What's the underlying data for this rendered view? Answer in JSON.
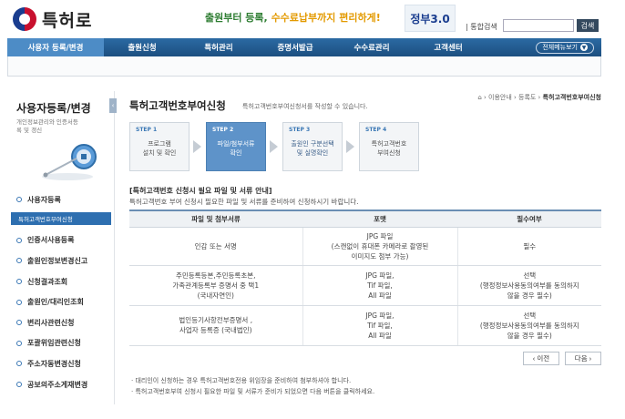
{
  "header": {
    "logo_text": "특허로",
    "slogan_prefix": "출원부터 등록, ",
    "slogan_highlight": "수수료납부까지 편리하게!",
    "gov_badge": "정부3.0",
    "search_label": "| 통합검색",
    "search_value": "",
    "search_button": "검색"
  },
  "gnb": {
    "items": [
      {
        "label": "사용자 등록/변경"
      },
      {
        "label": "출원신청"
      },
      {
        "label": "특허관리"
      },
      {
        "label": "증명서발급"
      },
      {
        "label": "수수료관리"
      },
      {
        "label": "고객센터"
      }
    ],
    "all_menu": "전체메뉴보기"
  },
  "sidebar": {
    "title": "사용자등록/변경",
    "desc": "개인정보관리와 인증서등록 및 갱신",
    "collapse": "‹",
    "items": [
      {
        "label": "사용자등록"
      },
      {
        "label": "인증서사용등록"
      },
      {
        "label": "출원인정보변경신고"
      },
      {
        "label": "신청결과조회"
      },
      {
        "label": "출원인/대리인조회"
      },
      {
        "label": "변리사관련신청"
      },
      {
        "label": "포괄위임관련신청"
      },
      {
        "label": "주소자동변경신청"
      },
      {
        "label": "공보의주소게재변경"
      }
    ],
    "sub_active": "특허고객번호부여신청"
  },
  "main": {
    "breadcrumb_prefix": "⌂ › 이용안내 › 등록도 › ",
    "breadcrumb_current": "특허고객번호부여신청",
    "title": "특허고객번호부여신청",
    "subtitle": "특허고객번호부여신청서를 작성할 수 있습니다.",
    "steps": [
      {
        "num": "STEP 1",
        "label": "프로그램\n설치 및 확인"
      },
      {
        "num": "STEP 2",
        "label": "파일/첨부서류\n확인"
      },
      {
        "num": "STEP 3",
        "label": "출원인 구분선택\n및 실명확인"
      },
      {
        "num": "STEP 4",
        "label": "특허고객번호\n부여신청"
      }
    ],
    "notice_title": "[특허고객번호 신청시 필요 파일 및 서류 안내]",
    "notice_sub": "특허고객번호 부여 신청시 필요한 파일 및 서류를 준비하여 신청하시기 바랍니다.",
    "table": {
      "headers": [
        "파일 및 첨부서류",
        "포맷",
        "필수여부"
      ],
      "rows": [
        {
          "doc": "인감 또는 서명",
          "format": "JPG 파일\n(스캔없이 휴대폰 카메라로 촬영된\n이미지도 첨부 가능)",
          "required": "필수"
        },
        {
          "doc": "주민등록등본,주민등록초본,\n가족관계등록부 증명서 중 택1\n(국내자연인)",
          "format": "JPG 파일,\nTif 파일,\nAll 파일",
          "required": "선택\n(행정정보사용동의여부를 동의하지\n않을 경우 필수)"
        },
        {
          "doc": "법인등기사항전부증명서 ,\n사업자 등록증 (국내법인)",
          "format": "JPG 파일,\nTif 파일,\nAll 파일",
          "required": "선택\n(행정정보사용동의여부를 동의하지\n않을 경우 필수)"
        }
      ]
    },
    "prev_button": "‹ 이전",
    "next_button": "다음 ›",
    "notes": [
      "· 대리인이 신청하는 경우 특허고객번호전용 위임장을 준비하여 첨부하셔야 합니다.",
      "· 특허고객번호부여 신청시 필요한 파일 및 서류가 준비가 되었으면 다음 버튼을 클릭하세요."
    ]
  }
}
